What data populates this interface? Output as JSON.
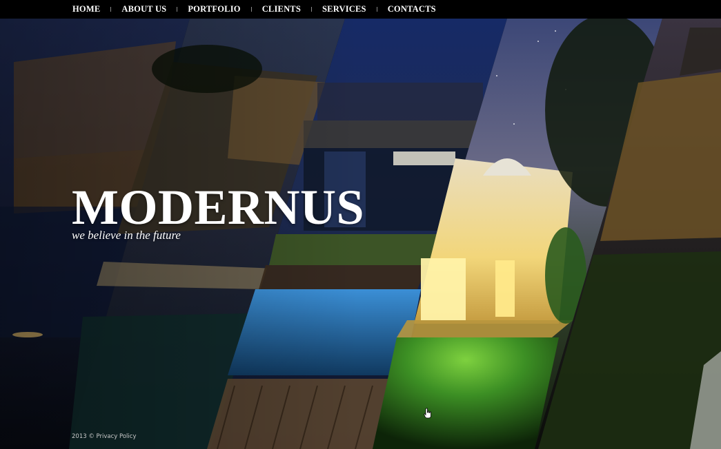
{
  "nav": {
    "items": [
      {
        "label": "HOME"
      },
      {
        "label": "ABOUT US"
      },
      {
        "label": "PORTFOLIO"
      },
      {
        "label": "CLIENTS"
      },
      {
        "label": "SERVICES"
      },
      {
        "label": "CONTACTS"
      }
    ]
  },
  "hero": {
    "title": "MODERNUS",
    "tagline": "we believe in the future"
  },
  "footer": {
    "copyright": "2013 ©",
    "privacy_link": "Privacy Policy"
  },
  "icons": {
    "cursor": "hand-pointer-icon"
  },
  "colors": {
    "nav_bar": "#000000",
    "text": "#ffffff",
    "night_sky": "#1f2a55",
    "pool": "#2d7fc4",
    "lawn": "#3fae2c",
    "window_glow": "#ffd862"
  }
}
